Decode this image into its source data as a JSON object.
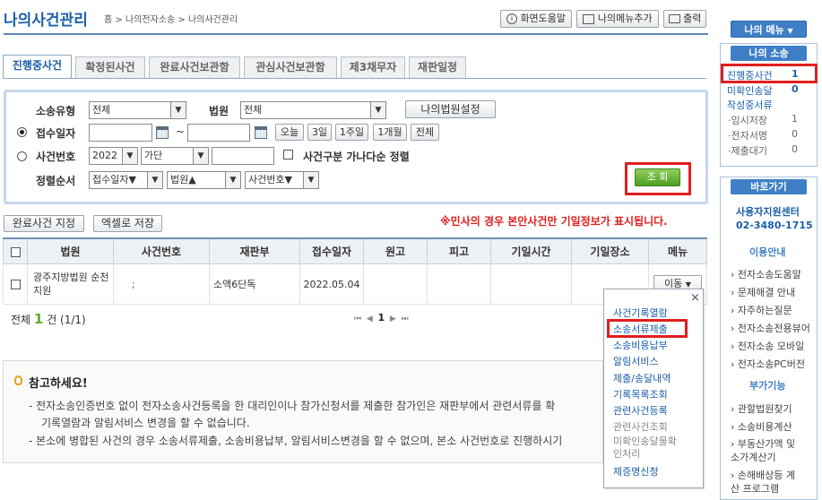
{
  "header": {
    "title": "나의사건관리",
    "breadcrumb": [
      "홈",
      "나의전자소송",
      "나의사건관리"
    ],
    "breadcrumb_sep": ">",
    "buttons": {
      "help": "화면도움말",
      "add_menu": "나의메뉴추가",
      "print": "출력"
    }
  },
  "tabs": [
    "진행중사건",
    "확정된사건",
    "완료사건보관함",
    "관심사건보관함",
    "제3채무자",
    "재판일정"
  ],
  "search": {
    "case_type_label": "소송유형",
    "case_type_value": "전체",
    "court_label": "법원",
    "court_value": "전체",
    "my_court_button": "나의법원설정",
    "receipt_date_label": "접수일자",
    "tilde": "~",
    "date_buttons": [
      "오늘",
      "3일",
      "1주일",
      "1개월",
      "전체"
    ],
    "case_no_label": "사건번호",
    "year_value": "2022",
    "category_value": "가단",
    "sort_check_label": "사건구분 가나다순 정렬",
    "order_label": "정렬순서",
    "order_selects": [
      "접수일자▼",
      "법원▲",
      "사건번호▼"
    ],
    "search_button": "조 회"
  },
  "actions": {
    "complete_button": "완료사건 지정",
    "excel_button": "엑셀로 저장"
  },
  "notice_red": "※민사의 경우 본안사건만 기일정보가 표시됩니다.",
  "table": {
    "headers": [
      "법원",
      "사건번호",
      "재판부",
      "접수일자",
      "원고",
      "피고",
      "기일시간",
      "기일장소",
      "메뉴"
    ],
    "rows": [
      {
        "court": "광주지방법원 순천지원",
        "case_no": ";",
        "division": "소액6단독",
        "date": "2022.05.04",
        "plaintiff": "",
        "defendant": "",
        "hearing_time": "",
        "hearing_place": "",
        "menu": "이동"
      }
    ]
  },
  "summary": {
    "total_prefix": "전체",
    "count": "1",
    "suffix": "건 (1/1)"
  },
  "pager": {
    "first": "⏮",
    "prev": "◀",
    "current": "1",
    "next": "▶",
    "last": "⏭"
  },
  "dropdown_menu": {
    "close": "×",
    "items": [
      "사건기록열람",
      "소송서류제출",
      "소송비용납부",
      "알림서비스",
      "제출/송달내역",
      "기록목록조회",
      "관련사건등록",
      "관련사건조회",
      "미확인송달물확인처리",
      "제증명신청"
    ]
  },
  "reference": {
    "title": "참고하세요!",
    "lines": [
      "- 전자소송인증번호 없이 전자소송사건등록을 한 대리인이나 참가신청서를 제출한 참가인은 재판부에서 관련서류를 확",
      "기록열람과 알림서비스 변경을 할 수 없습니다.",
      "- 본소에 병합된 사건의 경우 소송서류제출, 소송비용납부, 알림서비스변경을 할 수 없으며, 본소 사건번호로 진행하시기"
    ]
  },
  "sidebar": {
    "my_menu": "나의 메뉴",
    "my_lawsuit": "나의 소송",
    "lawsuit_items": [
      {
        "label": "진행중사건",
        "count": "1"
      },
      {
        "label": "미확인송달",
        "count": "0"
      },
      {
        "label": "작성중서류",
        "count": ""
      }
    ],
    "draft_items": [
      {
        "label": "·임시저장",
        "count": "1"
      },
      {
        "label": "·전자서명",
        "count": "0"
      },
      {
        "label": "·제출대기",
        "count": "0"
      }
    ],
    "shortcut": "바로가기",
    "help_center": "사용자지원센터",
    "phone": "02-3480-1715",
    "guide_title": "이용안내",
    "guide_items": [
      "전자소송도움말",
      "문제해결 안내",
      "자주하는질문",
      "전자소송전용뷰어",
      "전자소송 모바일",
      "전자소송PC버전"
    ],
    "extra_title": "부가기능",
    "extra_items": [
      "관할법원찾기",
      "소송비용계산",
      "부동산가액 및 소가계산기",
      "손해배상등 계산 프로그램"
    ]
  },
  "colors": {
    "accent_blue": "#1b5fa8",
    "side_button": "#3f7fc6",
    "highlight_red": "#e01e1e",
    "green_button": "#5cac2c"
  },
  "icons": [
    "question-icon",
    "menu-add-icon",
    "printer-icon",
    "calendar-icon",
    "bulb-icon",
    "chevron-down-icon"
  ]
}
